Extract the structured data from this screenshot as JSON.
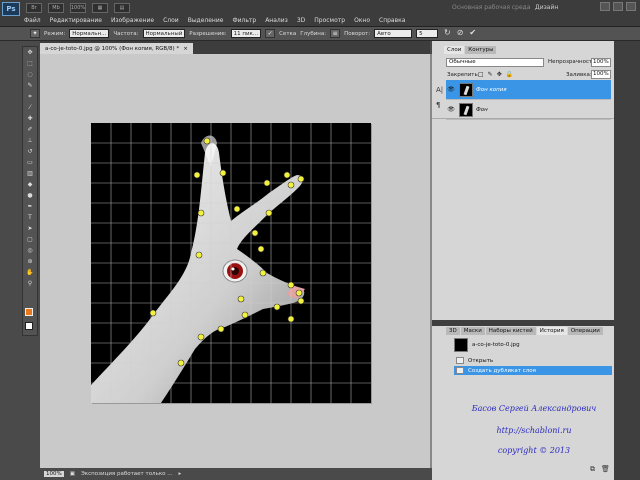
{
  "app": {
    "logo": "Ps",
    "zoom_display": "100%",
    "workspace_label": "Основная рабочая среда",
    "design_label": "Дизайн"
  },
  "menu": [
    "Файл",
    "Редактирование",
    "Изображение",
    "Слои",
    "Выделение",
    "Фильтр",
    "Анализ",
    "3D",
    "Просмотр",
    "Окно",
    "Справка"
  ],
  "options": {
    "mode_label": "Режим:",
    "mode_value": "Нормальн...",
    "frequency_label": "Частота:",
    "frequency_value": "Нормальный",
    "resolution_label": "Разрешение:",
    "resolution_value": "11 пик...",
    "grid_label": "Сетка",
    "depth_label": "Глубина:",
    "rotate_label": "Поворот:",
    "rotate_value": "Авто",
    "rotate_number": "5"
  },
  "document": {
    "tab_title": "a-co-je-toto-0.jpg @ 100% (Фон копия, RGB/8) *",
    "status_zoom": "100%",
    "status_text": "Экспозиция работает только ..."
  },
  "layers_panel": {
    "tabs": [
      {
        "label": "Слои",
        "active": true
      },
      {
        "label": "Контуры",
        "active": false
      }
    ],
    "blend_mode": "Обычные",
    "opacity_label": "Непрозрачность:",
    "opacity_value": "100%",
    "lock_label": "Закрепить:",
    "fill_label": "Заливка:",
    "fill_value": "100%",
    "layers": [
      {
        "name": "Фон копия",
        "selected": true
      },
      {
        "name": "Фон",
        "selected": false
      }
    ]
  },
  "history_panel": {
    "tabs": [
      {
        "label": "3D",
        "active": false
      },
      {
        "label": "Маски",
        "active": false
      },
      {
        "label": "Наборы кистей",
        "active": false
      },
      {
        "label": "История",
        "active": true
      },
      {
        "label": "Операции",
        "active": false
      }
    ],
    "snapshot": "a-co-je-toto-0.jpg",
    "items": [
      {
        "label": "Открыть",
        "selected": false
      },
      {
        "label": "Создать дубликат слоя",
        "selected": true
      }
    ]
  },
  "credits": {
    "author": "Басов Сергей Александрович",
    "url": "http://schabloni.ru",
    "copyright": "copyright © 2013"
  },
  "colors": {
    "foreground": "#e87a1d",
    "background": "#ffffff",
    "selection": "#3b95e6",
    "credit_text": "#2a2ac0"
  }
}
